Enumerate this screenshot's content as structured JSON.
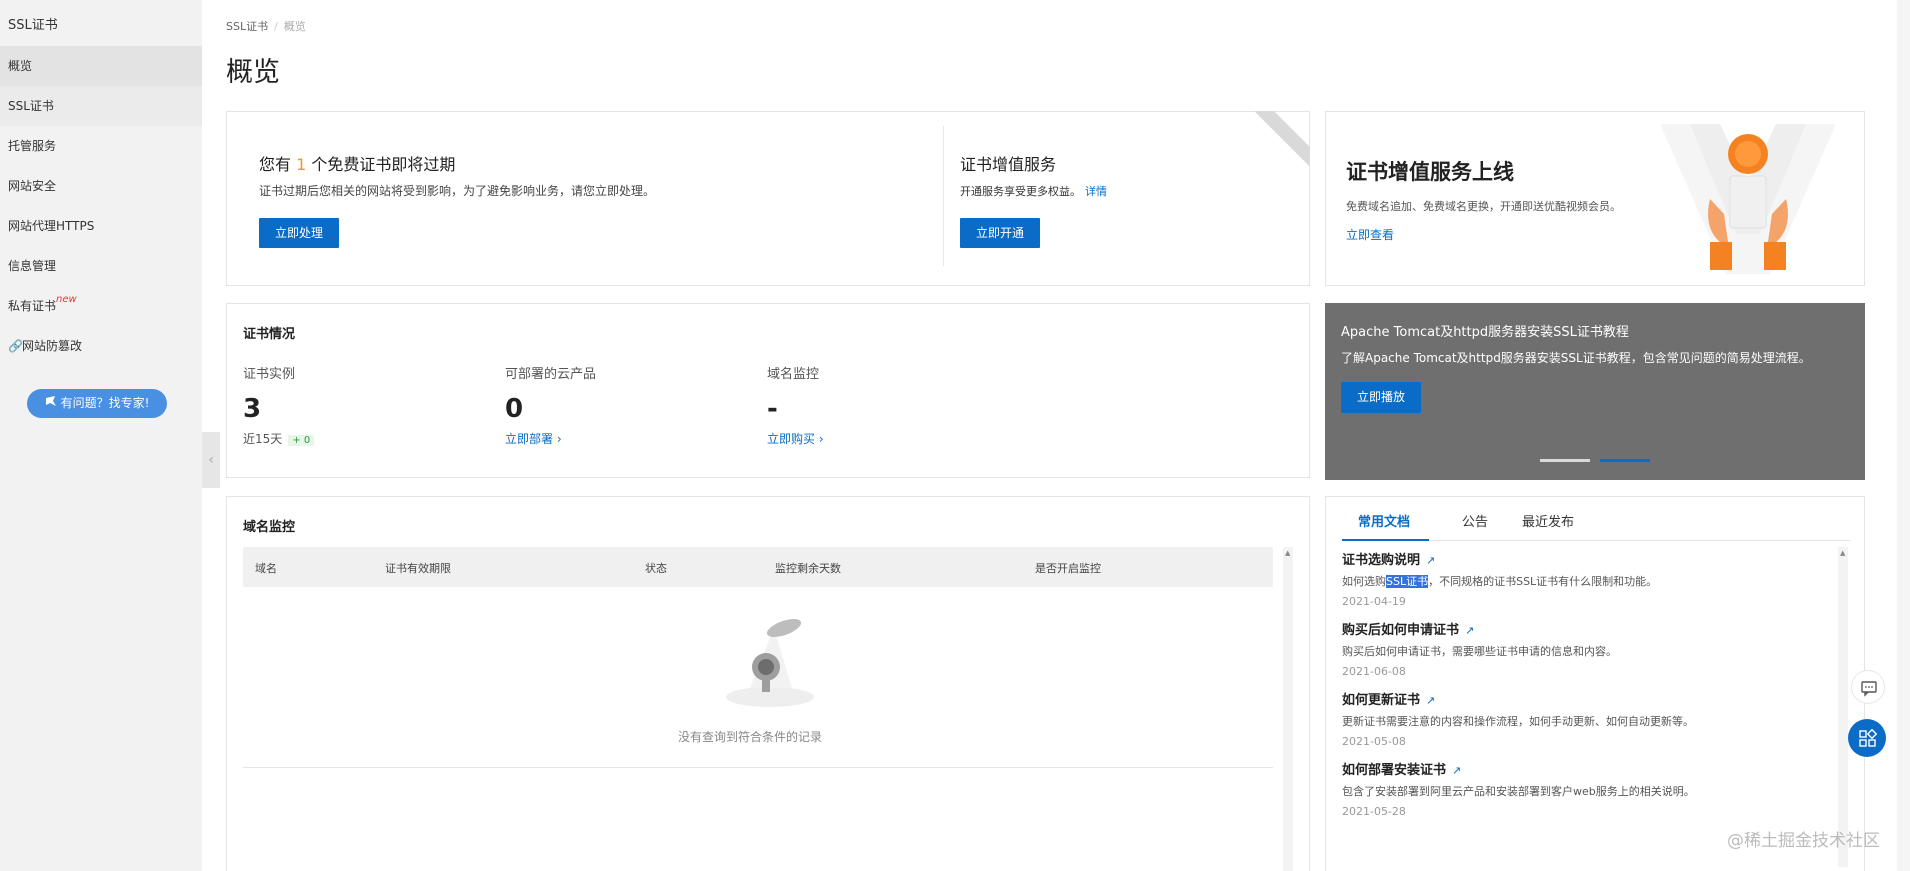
{
  "sidebar": {
    "title": "SSL证书",
    "items": [
      {
        "label": "概览"
      },
      {
        "label": "SSL证书"
      },
      {
        "label": "托管服务"
      },
      {
        "label": "网站安全"
      },
      {
        "label": "网站代理HTTPS"
      },
      {
        "label": "信息管理"
      },
      {
        "label": "私有证书",
        "badge": "new"
      },
      {
        "label": "网站防篡改"
      }
    ],
    "expert_button": "有问题？找专家!"
  },
  "breadcrumb": {
    "root": "SSL证书",
    "sep": "/",
    "current": "概览"
  },
  "page_title": "概览",
  "expiry": {
    "title_prefix": "您有",
    "count": "1",
    "title_suffix": "个免费证书即将过期",
    "desc": "证书过期后您相关的网站将受到影响，为了避免影响业务，请您立即处理。",
    "button": "立即处理"
  },
  "value_added": {
    "title": "证书增值服务",
    "desc": "开通服务享受更多权益。",
    "link": "详情",
    "button": "立即开通"
  },
  "promo": {
    "title": "证书增值服务上线",
    "desc": "免费域名追加、免费域名更换，开通即送优酷视频会员。",
    "link": "立即查看"
  },
  "cert_status": {
    "title": "证书情况",
    "stats": [
      {
        "label": "证书实例",
        "value": "3",
        "sub": "近15天",
        "delta": "+ 0"
      },
      {
        "label": "可部署的云产品",
        "value": "0",
        "link": "立即部署 ›"
      },
      {
        "label": "域名监控",
        "value": "-",
        "link": "立即购买 ›"
      }
    ]
  },
  "carousel": {
    "title": "Apache Tomcat及httpd服务器安装SSL证书教程",
    "desc": "了解Apache Tomcat及httpd服务器安装SSL证书教程，包含常见问题的简易处理流程。",
    "button": "立即播放"
  },
  "domain_monitor": {
    "title": "域名监控",
    "columns": [
      "域名",
      "证书有效期限",
      "状态",
      "监控剩余天数",
      "是否开启监控"
    ],
    "empty_text": "没有查询到符合条件的记录"
  },
  "docs": {
    "tabs": [
      "常用文档",
      "公告",
      "最近发布"
    ],
    "items": [
      {
        "title": "证书选购说明",
        "desc_pre": "如何选购",
        "desc_hl": "SSL证书",
        "desc_post": "，不同规格的证书SSL证书有什么限制和功能。",
        "date": "2021-04-19"
      },
      {
        "title": "购买后如何申请证书",
        "desc": "购买后如何申请证书，需要哪些证书申请的信息和内容。",
        "date": "2021-06-08"
      },
      {
        "title": "如何更新证书",
        "desc": "更新证书需要注意的内容和操作流程，如何手动更新、如何自动更新等。",
        "date": "2021-05-08"
      },
      {
        "title": "如何部署安装证书",
        "desc": "包含了安装部署到阿里云产品和安装部署到客户web服务上的相关说明。",
        "date": "2021-05-28"
      }
    ]
  },
  "watermark": "@稀土掘金技术社区",
  "colors": {
    "accent": "#0a6cc7",
    "warning": "#e89b2a",
    "carousel_bg": "#6f6f6f"
  }
}
